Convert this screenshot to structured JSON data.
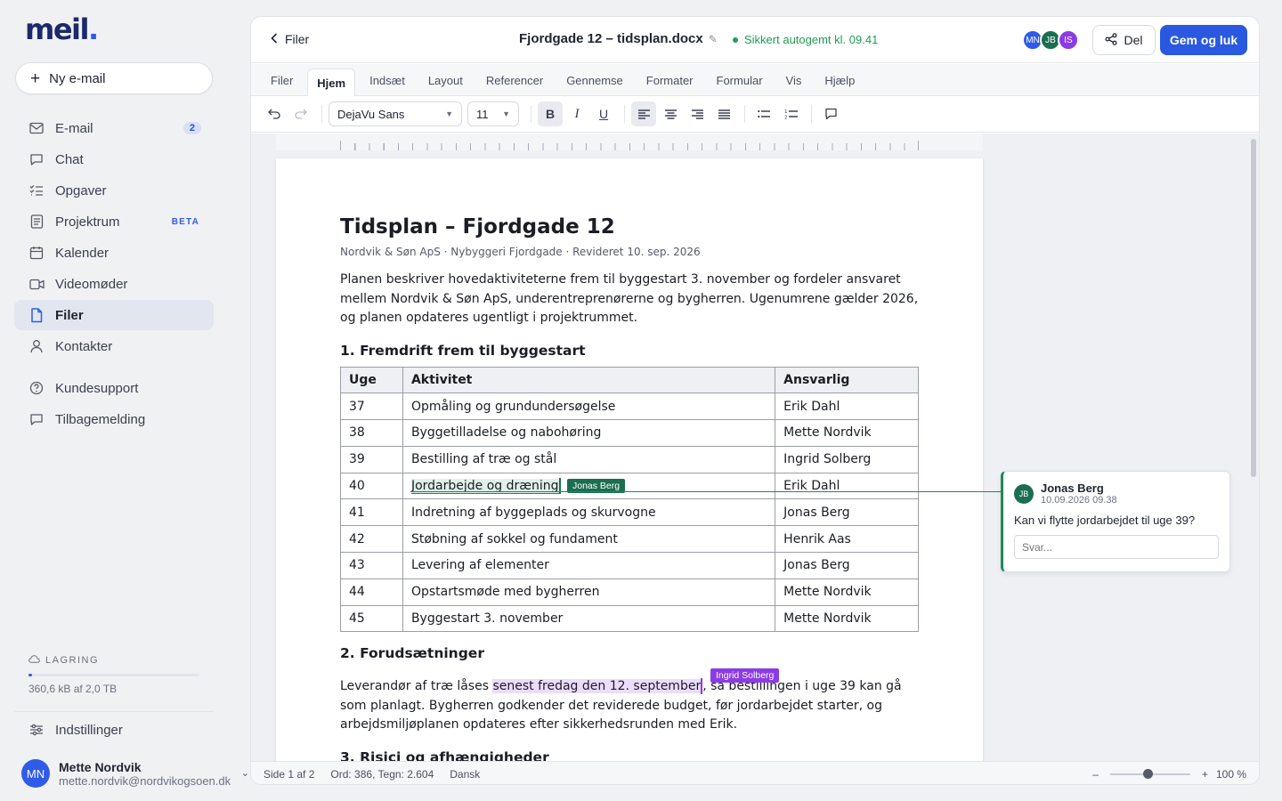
{
  "app": {
    "logo_text": "meil",
    "logo_dot": "."
  },
  "sidebar": {
    "compose_label": "Ny e-mail",
    "nav": [
      {
        "label": "E-mail",
        "icon": "mail-icon",
        "badge": "2"
      },
      {
        "label": "Chat",
        "icon": "chat-icon"
      },
      {
        "label": "Opgaver",
        "icon": "tasks-icon"
      },
      {
        "label": "Projektrum",
        "icon": "project-icon",
        "tag": "BETA"
      },
      {
        "label": "Kalender",
        "icon": "calendar-icon"
      },
      {
        "label": "Videomøder",
        "icon": "video-icon"
      },
      {
        "label": "Filer",
        "icon": "file-icon",
        "active": true
      },
      {
        "label": "Kontakter",
        "icon": "contacts-icon"
      }
    ],
    "secondary": [
      {
        "label": "Kundesupport",
        "icon": "help-icon"
      },
      {
        "label": "Tilbagemelding",
        "icon": "feedback-icon"
      }
    ],
    "storage": {
      "title": "LAGRING",
      "text": "360,6 kB af 2,0 TB",
      "used_fraction": 0.02
    },
    "settings_label": "Indstillinger",
    "user": {
      "initials": "MN",
      "name": "Mette Nordvik",
      "email": "mette.nordvik@nordvikogsoen.dk"
    }
  },
  "topbar": {
    "back_label": "Filer",
    "doc_title": "Fjordgade 12 – tidsplan.docx",
    "saved_text": "Sikkert autogemt kl. 09.41",
    "collaborators": [
      {
        "initials": "MN",
        "color": "#2f5bea"
      },
      {
        "initials": "JB",
        "color": "#1b6e50"
      },
      {
        "initials": "IS",
        "color": "#8b3ce6"
      }
    ],
    "share_label": "Del",
    "save_close_label": "Gem og luk"
  },
  "tabs": [
    "Filer",
    "Hjem",
    "Indsæt",
    "Layout",
    "Referencer",
    "Gennemse",
    "Formater",
    "Formular",
    "Vis",
    "Hjælp"
  ],
  "active_tab": "Hjem",
  "toolbar": {
    "font": "DejaVu Sans",
    "size": "11"
  },
  "document": {
    "title": "Tidsplan – Fjordgade 12",
    "meta": "Nordvik & Søn ApS · Nybyggeri Fjordgade · Revideret 10. sep. 2026",
    "intro": "Planen beskriver hovedaktiviteterne frem til byggestart 3. november og fordeler ansvaret mellem Nordvik & Søn ApS, underentreprenørerne og bygherren. Ugenumrene gælder 2026, og planen opdateres ugentligt i projektrummet.",
    "section1": "1. Fremdrift frem til byggestart",
    "table_headers": [
      "Uge",
      "Aktivitet",
      "Ansvarlig"
    ],
    "rows": [
      [
        "37",
        "Opmåling og grundundersøgelse",
        "Erik Dahl"
      ],
      [
        "38",
        "Byggetilladelse og nabohøring",
        "Mette Nordvik"
      ],
      [
        "39",
        "Bestilling af træ og stål",
        "Ingrid Solberg"
      ],
      [
        "40",
        "Jordarbejde og dræning",
        "Erik Dahl"
      ],
      [
        "41",
        "Indretning af byggeplads og skurvogne",
        "Jonas Berg"
      ],
      [
        "42",
        "Støbning af sokkel og fundament",
        "Henrik Aas"
      ],
      [
        "43",
        "Levering af elementer",
        "Jonas Berg"
      ],
      [
        "44",
        "Opstartsmøde med bygherren",
        "Mette Nordvik"
      ],
      [
        "45",
        "Byggestart 3. november",
        "Mette Nordvik"
      ]
    ],
    "jonas_flag": "Jonas Berg",
    "section2": "2. Forudsætninger",
    "p2_before": "Leverandør af træ låses ",
    "p2_highlight": "senest fredag den 12. september",
    "p2_after": ", så bestillingen i uge 39 kan gå som planlagt. Bygherren godkender det reviderede budget, før jordarbejdet starter, og arbejdsmiljøplanen opdateres efter sikkerhedsrunden med Erik.",
    "ingrid_flag": "Ingrid Solberg",
    "section3": "3. Risici og afhængigheder"
  },
  "comment": {
    "initials": "JB",
    "author": "Jonas Berg",
    "time": "10.09.2026 09.38",
    "text": "Kan vi flytte jordarbejdet til uge 39?",
    "reply_placeholder": "Svar..."
  },
  "status": {
    "page": "Side 1 af 2",
    "counts": "Ord: 386, Tegn: 2.604",
    "language": "Dansk",
    "zoom_minus": "–",
    "zoom_plus": "+",
    "zoom": "100 %",
    "zoom_fraction": 0.47
  },
  "colors": {
    "accent": "#2a58e0",
    "jonas": "#1b6e50",
    "ingrid": "#8b3ce6",
    "saved": "#1f9d55"
  }
}
